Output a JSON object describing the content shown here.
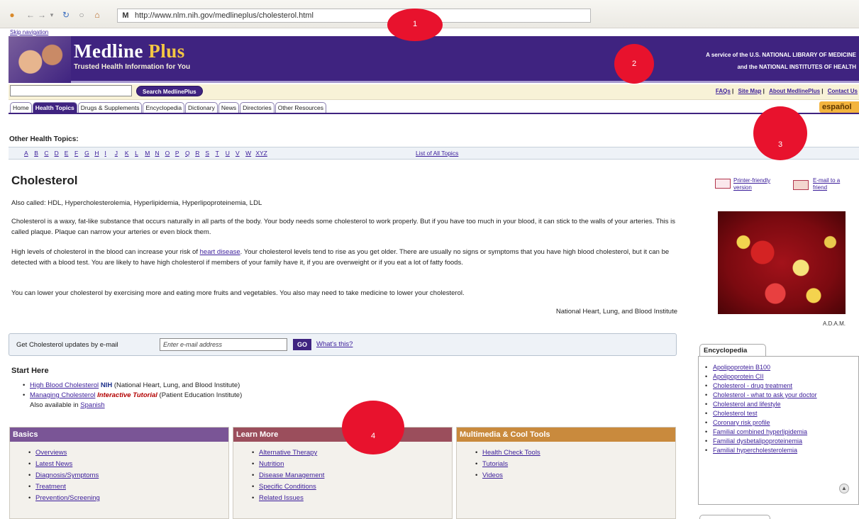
{
  "browser": {
    "url": "http://www.nlm.nih.gov/medlineplus/cholesterol.html",
    "favicon": "M",
    "skip_link": "Skip navigation"
  },
  "header": {
    "logo_main": "Medline",
    "logo_plus": "Plus",
    "tagline": "Trusted Health Information for You",
    "service_line1": "A service of the U.S. NATIONAL LIBRARY OF MEDICINE",
    "service_line2": "and the NATIONAL INSTITUTES OF HEALTH"
  },
  "search": {
    "button_label": "Search MedlinePlus",
    "top_links": [
      "FAQs",
      "Site Map",
      "About MedlinePlus",
      "Contact Us"
    ]
  },
  "tabs": [
    {
      "label": "Home",
      "active": false
    },
    {
      "label": "Health Topics",
      "active": true
    },
    {
      "label": "Drugs & Supplements",
      "active": false
    },
    {
      "label": "Encyclopedia",
      "active": false
    },
    {
      "label": "Dictionary",
      "active": false
    },
    {
      "label": "News",
      "active": false
    },
    {
      "label": "Directories",
      "active": false
    },
    {
      "label": "Other Resources",
      "active": false
    }
  ],
  "espanol": "español",
  "other_topics": {
    "title": "Other Health Topics:",
    "letters": [
      "A",
      "B",
      "C",
      "D",
      "E",
      "F",
      "G",
      "H",
      "I",
      "J",
      "K",
      "L",
      "M",
      "N",
      "O",
      "P",
      "Q",
      "R",
      "S",
      "T",
      "U",
      "V",
      "W",
      "XYZ"
    ],
    "all_link": "List of All Topics"
  },
  "article": {
    "title": "Cholesterol",
    "also_called": "Also called: HDL, Hypercholesterolemia, Hyperlipidemia, Hyperlipoproteinemia, LDL",
    "p1": "Cholesterol is a waxy, fat-like substance that occurs naturally in all parts of the body. Your body needs some cholesterol to work properly. But if you have too much in your blood, it can stick to the walls of your arteries. This is called plaque. Plaque can narrow your arteries or even block them.",
    "p2_before": "High levels of cholesterol in the blood can increase your risk of ",
    "p2_link": "heart disease",
    "p2_after": ". Your cholesterol levels tend to rise as you get older. There are usually no signs or symptoms that you have high blood cholesterol, but it can be detected with a blood test. You are likely to have high cholesterol if members of your family have it, if you are overweight or if you eat a lot of fatty foods.",
    "p3": "You can lower your cholesterol by exercising more and eating more fruits and vegetables. You also may need to take medicine to lower your cholesterol.",
    "attribution": "National Heart, Lung, and Blood Institute"
  },
  "email_updates": {
    "label": "Get Cholesterol updates by e-mail",
    "placeholder": "Enter e-mail address",
    "go": "GO",
    "whats_this": "What's this?"
  },
  "start_here": {
    "title": "Start Here",
    "item1_link": "High Blood Cholesterol",
    "item1_tag": "NIH",
    "item1_source": "(National Heart, Lung, and Blood Institute)",
    "item2_link": "Managing Cholesterol",
    "item2_tag": "Interactive Tutorial",
    "item2_source": "(Patient Education Institute)",
    "item2_avail_prefix": "Also available in ",
    "item2_avail_link": "Spanish"
  },
  "categories": {
    "basics": {
      "title": "Basics",
      "color": "#7a5596",
      "items": [
        "Overviews",
        "Latest News",
        "Diagnosis/Symptoms",
        "Treatment",
        "Prevention/Screening"
      ]
    },
    "learn_more": {
      "title": "Learn More",
      "color": "#9b4e5c",
      "items": [
        "Alternative Therapy",
        "Nutrition",
        "Disease Management",
        "Specific Conditions",
        "Related Issues"
      ]
    },
    "multimedia": {
      "title": "Multimedia & Cool Tools",
      "color": "#c98a3d",
      "items": [
        "Health Check Tools",
        "Tutorials",
        "Videos"
      ]
    }
  },
  "sidebar": {
    "printer_friendly": "Printer-friendly version",
    "email_friend": "E-mail to a friend",
    "image_credit": "A.D.A.M.",
    "encyclopedia_tab": "Encyclopedia",
    "encyclopedia_items": [
      "Apolipoprotein B100",
      "Apolipoprotein CII",
      "Cholesterol - drug treatment",
      "Cholesterol - what to ask your doctor",
      "Cholesterol and lifestyle",
      "Cholesterol test",
      "Coronary risk profile",
      "Familial combined hyperlipidemia",
      "Familial dysbetalipoproteinemia",
      "Familial hypercholesterolemia"
    ]
  },
  "markers": [
    "1",
    "2",
    "3",
    "4"
  ]
}
